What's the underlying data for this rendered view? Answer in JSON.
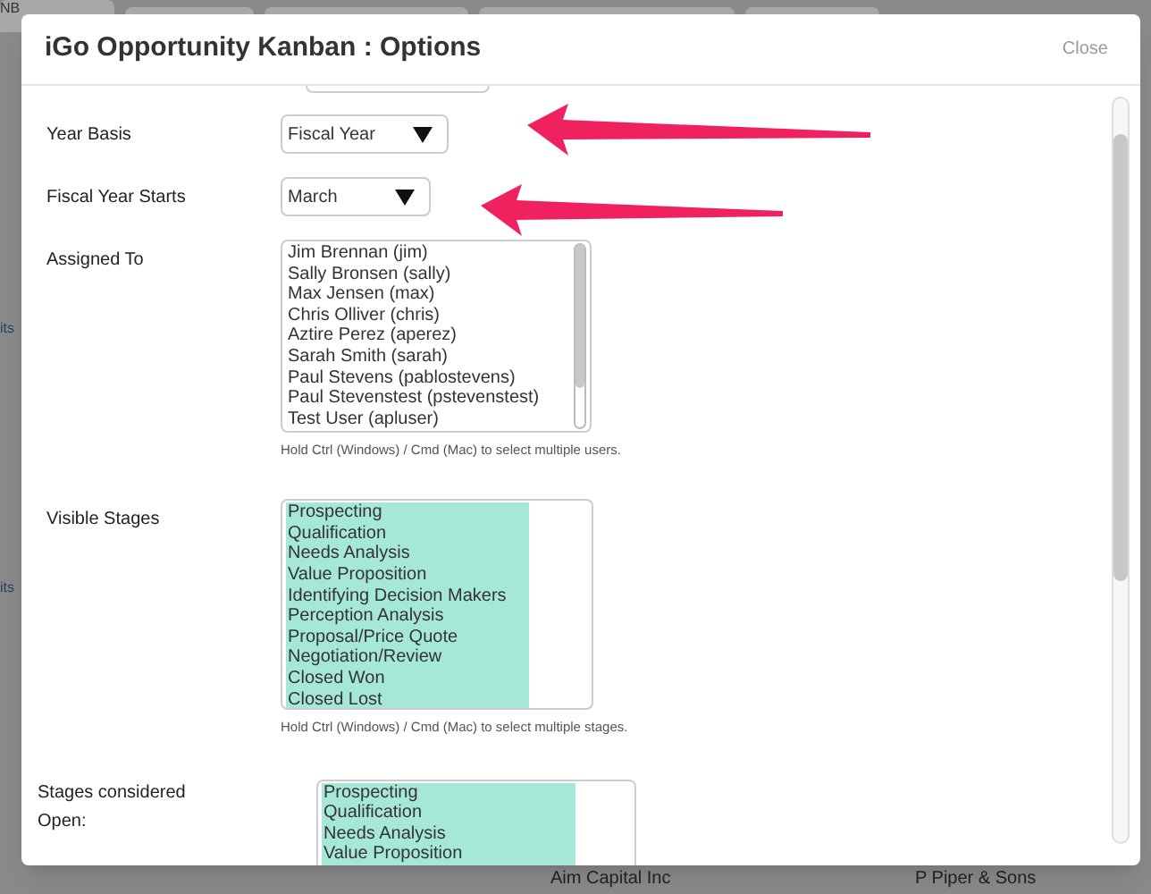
{
  "backdrop": {
    "tab_fragment": "NB",
    "left_fragments": [
      "its",
      "its"
    ],
    "bottom_fragments": [
      "Aim Capital Inc",
      "P Piper & Sons"
    ]
  },
  "dialog": {
    "title": "iGo Opportunity Kanban : Options",
    "close_label": "Close"
  },
  "fields": [
    {
      "kind": "select",
      "label": "Year Basis",
      "value": "Fiscal Year"
    },
    {
      "kind": "select",
      "label": "Fiscal Year Starts",
      "value": "March"
    },
    {
      "kind": "listbox",
      "label": "Assigned To",
      "hint": "Hold Ctrl (Windows) / Cmd (Mac) to select multiple users.",
      "options": [
        {
          "label": "Jim Brennan (jim)",
          "selected": false
        },
        {
          "label": "Sally Bronsen (sally)",
          "selected": false
        },
        {
          "label": "Max Jensen (max)",
          "selected": false
        },
        {
          "label": "Chris Olliver (chris)",
          "selected": false
        },
        {
          "label": "Aztire Perez (aperez)",
          "selected": false
        },
        {
          "label": "Sarah Smith (sarah)",
          "selected": false
        },
        {
          "label": "Paul Stevens (pablostevens)",
          "selected": false
        },
        {
          "label": "Paul Stevenstest (pstevenstest)",
          "selected": false
        },
        {
          "label": "Test User (apluser)",
          "selected": false
        }
      ]
    },
    {
      "kind": "listbox",
      "label": "Visible Stages",
      "hint": "Hold Ctrl (Windows) / Cmd (Mac) to select multiple stages.",
      "options": [
        {
          "label": "Prospecting",
          "selected": true
        },
        {
          "label": "Qualification",
          "selected": true
        },
        {
          "label": "Needs Analysis",
          "selected": true
        },
        {
          "label": "Value Proposition",
          "selected": true
        },
        {
          "label": "Identifying Decision Makers",
          "selected": true
        },
        {
          "label": "Perception Analysis",
          "selected": true
        },
        {
          "label": "Proposal/Price Quote",
          "selected": true
        },
        {
          "label": "Negotiation/Review",
          "selected": true
        },
        {
          "label": "Closed Won",
          "selected": true
        },
        {
          "label": "Closed Lost",
          "selected": true
        }
      ]
    },
    {
      "kind": "listbox",
      "label": "Stages considered Open:",
      "options": [
        {
          "label": "Prospecting",
          "selected": true
        },
        {
          "label": "Qualification",
          "selected": true
        },
        {
          "label": "Needs Analysis",
          "selected": true
        },
        {
          "label": "Value Proposition",
          "selected": true
        }
      ]
    }
  ]
}
